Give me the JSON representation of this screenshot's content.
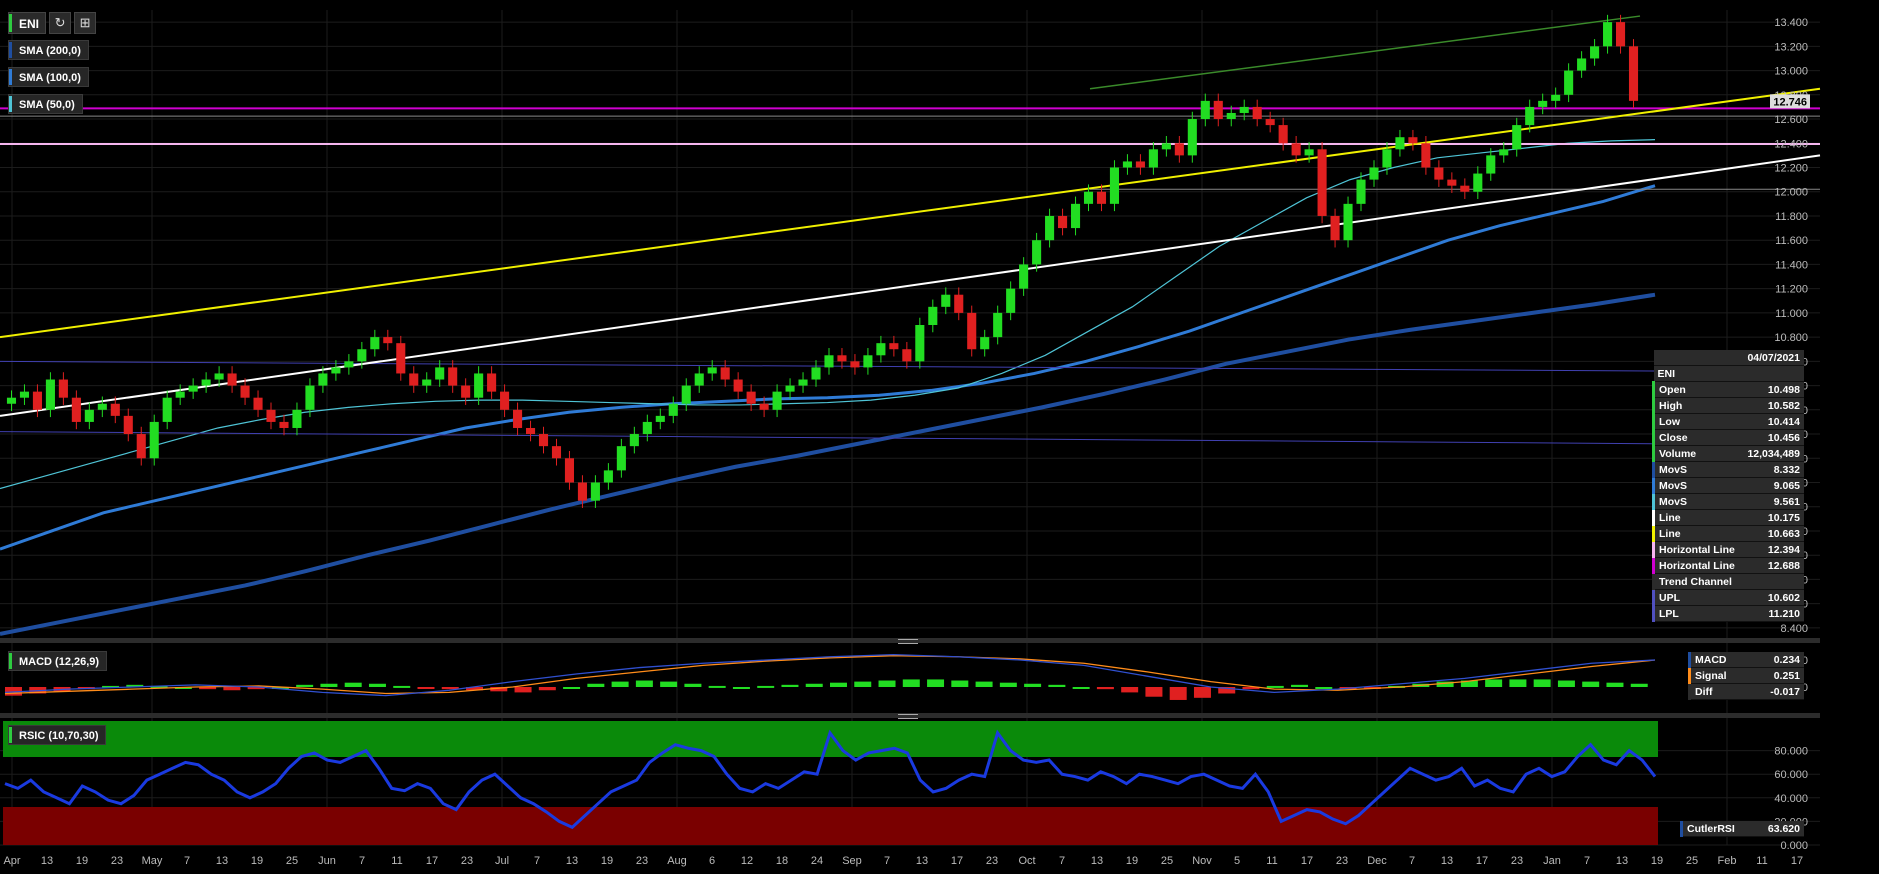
{
  "ticker": {
    "symbol": "ENI",
    "refresh_icon": "refresh-icon",
    "menu_icon": "grid-icon"
  },
  "overlays": [
    {
      "label": "SMA (200,0)",
      "color": "#1f4ea0"
    },
    {
      "label": "SMA (100,0)",
      "color": "#2f7bd6"
    },
    {
      "label": "SMA (50,0)",
      "color": "#4fc4d6"
    }
  ],
  "price_axis": {
    "ticks": [
      "13.400",
      "13.200",
      "13.000",
      "12.800",
      "12.600",
      "12.400",
      "12.200",
      "12.000",
      "11.800",
      "11.600",
      "11.400",
      "11.200",
      "11.000",
      "10.800",
      "10.600",
      "10.400",
      "10.200",
      "10.000",
      "9.800",
      "9.600",
      "9.400",
      "9.200",
      "9.000",
      "8.800",
      "8.600",
      "8.400"
    ],
    "last_price": "12.746"
  },
  "date_axis": [
    "Apr",
    "13",
    "19",
    "23",
    "May",
    "7",
    "13",
    "19",
    "25",
    "Jun",
    "7",
    "11",
    "17",
    "23",
    "Jul",
    "7",
    "13",
    "19",
    "23",
    "Aug",
    "6",
    "12",
    "18",
    "24",
    "Sep",
    "7",
    "13",
    "17",
    "23",
    "Oct",
    "7",
    "13",
    "19",
    "25",
    "Nov",
    "5",
    "11",
    "17",
    "23",
    "Dec",
    "7",
    "13",
    "17",
    "23",
    "Jan",
    "7",
    "13",
    "19",
    "25",
    "Feb",
    "11",
    "17"
  ],
  "info_panel": {
    "date": "04/07/2021",
    "name": "ENI",
    "rows": [
      {
        "label": "Open",
        "value": "10.498",
        "color": "#2ecc40"
      },
      {
        "label": "High",
        "value": "10.582",
        "color": "#2ecc40"
      },
      {
        "label": "Low",
        "value": "10.414",
        "color": "#2ecc40"
      },
      {
        "label": "Close",
        "value": "10.456",
        "color": "#2ecc40"
      },
      {
        "label": "Volume",
        "value": "12,034,489",
        "color": "#2ecc40"
      },
      {
        "label": "MovS",
        "value": "8.332",
        "color": "#1f4ea0"
      },
      {
        "label": "MovS",
        "value": "9.065",
        "color": "#2f7bd6"
      },
      {
        "label": "MovS",
        "value": "9.561",
        "color": "#4fc4d6"
      },
      {
        "label": "Line",
        "value": "10.175",
        "color": "#ffffff"
      },
      {
        "label": "Line",
        "value": "10.663",
        "color": "#f0f000"
      },
      {
        "label": "Horizontal Line",
        "value": "12.394",
        "color": "#f6b6f0"
      },
      {
        "label": "Horizontal Line",
        "value": "12.688",
        "color": "#d000d0"
      },
      {
        "label": "Trend Channel",
        "value": "",
        "color": "#2b2b2b"
      },
      {
        "label": "UPL",
        "value": "10.602",
        "color": "#5050c0"
      },
      {
        "label": "LPL",
        "value": "11.210",
        "color": "#5050c0"
      }
    ]
  },
  "macd": {
    "label": "MACD (12,26,9)",
    "axis": [
      "0.250",
      "0.000"
    ],
    "rows": [
      {
        "label": "MACD",
        "value": "0.234",
        "color": "#1f4ea0"
      },
      {
        "label": "Signal",
        "value": "0.251",
        "color": "#ff8c1a"
      },
      {
        "label": "Diff",
        "value": "-0.017",
        "color": "#2b2b2b"
      }
    ]
  },
  "rsi": {
    "label": "RSIC (10,70,30)",
    "axis": [
      "80.000",
      "60.000",
      "40.000",
      "20.000",
      "0.000"
    ],
    "row": {
      "label": "CutlerRSI",
      "value": "63.620",
      "color": "#1f4ea0"
    }
  },
  "chart_data": {
    "type": "candlestick",
    "x_axis": "date (Apr 2021 – Feb 2022)",
    "ylim": [
      8.3,
      13.5
    ],
    "close": [
      10.3,
      10.35,
      10.2,
      10.45,
      10.3,
      10.1,
      10.2,
      10.25,
      10.15,
      10.0,
      9.8,
      10.1,
      10.3,
      10.35,
      10.4,
      10.45,
      10.5,
      10.4,
      10.3,
      10.2,
      10.1,
      10.05,
      10.2,
      10.4,
      10.5,
      10.55,
      10.6,
      10.7,
      10.8,
      10.75,
      10.5,
      10.4,
      10.45,
      10.55,
      10.4,
      10.3,
      10.5,
      10.35,
      10.2,
      10.05,
      10.0,
      9.9,
      9.8,
      9.6,
      9.45,
      9.6,
      9.7,
      9.9,
      10.0,
      10.1,
      10.15,
      10.25,
      10.4,
      10.5,
      10.55,
      10.45,
      10.35,
      10.25,
      10.2,
      10.35,
      10.4,
      10.45,
      10.55,
      10.65,
      10.6,
      10.55,
      10.65,
      10.75,
      10.7,
      10.6,
      10.9,
      11.05,
      11.15,
      11.0,
      10.7,
      10.8,
      11.0,
      11.2,
      11.4,
      11.6,
      11.8,
      11.7,
      11.9,
      12.0,
      11.9,
      12.2,
      12.25,
      12.2,
      12.35,
      12.4,
      12.3,
      12.6,
      12.75,
      12.6,
      12.65,
      12.7,
      12.6,
      12.55,
      12.4,
      12.3,
      12.35,
      11.8,
      11.6,
      11.9,
      12.1,
      12.2,
      12.35,
      12.45,
      12.4,
      12.2,
      12.1,
      12.05,
      12.0,
      12.15,
      12.3,
      12.35,
      12.55,
      12.7,
      12.75,
      12.8,
      13.0,
      13.1,
      13.2,
      13.4,
      13.2,
      12.75
    ],
    "sma50": [
      9.55,
      9.65,
      9.75,
      9.85,
      9.95,
      10.05,
      10.12,
      10.18,
      10.22,
      10.25,
      10.27,
      10.28,
      10.28,
      10.27,
      10.26,
      10.25,
      10.24,
      10.24,
      10.25,
      10.26,
      10.28,
      10.32,
      10.38,
      10.5,
      10.65,
      10.85,
      11.05,
      11.3,
      11.55,
      11.75,
      11.95,
      12.1,
      12.2,
      12.28,
      12.32,
      12.36,
      12.4,
      12.42,
      12.43
    ],
    "sma100": [
      9.05,
      9.2,
      9.35,
      9.45,
      9.55,
      9.65,
      9.75,
      9.85,
      9.95,
      10.05,
      10.12,
      10.18,
      10.22,
      10.25,
      10.27,
      10.29,
      10.3,
      10.32,
      10.36,
      10.42,
      10.5,
      10.6,
      10.72,
      10.85,
      11.0,
      11.15,
      11.3,
      11.45,
      11.6,
      11.72,
      11.82,
      11.92,
      12.05
    ],
    "sma200": [
      8.35,
      8.45,
      8.55,
      8.65,
      8.75,
      8.87,
      9.0,
      9.12,
      9.25,
      9.38,
      9.5,
      9.62,
      9.73,
      9.82,
      9.92,
      10.02,
      10.12,
      10.22,
      10.33,
      10.45,
      10.58,
      10.68,
      10.78,
      10.86,
      10.93,
      11.0,
      11.07,
      11.15
    ],
    "horizontal_lines": [
      12.394,
      12.688
    ],
    "trend_lines": [
      {
        "color": "white",
        "start": 10.15,
        "end": 12.3
      },
      {
        "color": "yellow",
        "start": 10.8,
        "end": 12.85
      }
    ],
    "rsi": [
      52,
      48,
      55,
      45,
      40,
      35,
      50,
      45,
      38,
      35,
      42,
      55,
      60,
      65,
      70,
      68,
      60,
      55,
      45,
      40,
      45,
      52,
      65,
      75,
      78,
      72,
      70,
      75,
      80,
      65,
      48,
      46,
      52,
      48,
      35,
      30,
      45,
      55,
      60,
      50,
      40,
      35,
      28,
      20,
      15,
      25,
      35,
      45,
      50,
      55,
      70,
      78,
      85,
      82,
      80,
      75,
      60,
      48,
      45,
      52,
      48,
      55,
      62,
      60,
      95,
      80,
      72,
      78,
      80,
      82,
      78,
      55,
      45,
      48,
      55,
      60,
      58,
      95,
      80,
      72,
      70,
      72,
      60,
      58,
      55,
      62,
      58,
      52,
      60,
      58,
      55,
      52,
      58,
      60,
      55,
      50,
      48,
      60,
      45,
      20,
      25,
      30,
      28,
      22,
      18,
      25,
      35,
      45,
      55,
      65,
      60,
      55,
      58,
      65,
      50,
      55,
      48,
      45,
      60,
      65,
      58,
      62,
      75,
      85,
      72,
      68,
      80,
      72,
      58
    ],
    "macd_hist": [
      -0.08,
      -0.06,
      -0.04,
      -0.02,
      0.01,
      0.02,
      0.01,
      0.0,
      -0.02,
      -0.03,
      -0.02,
      0.0,
      0.02,
      0.03,
      0.04,
      0.03,
      0.01,
      -0.01,
      -0.02,
      -0.03,
      -0.04,
      -0.05,
      -0.03,
      0.0,
      0.03,
      0.05,
      0.06,
      0.05,
      0.03,
      0.01,
      0.0,
      0.01,
      0.02,
      0.03,
      0.04,
      0.05,
      0.06,
      0.07,
      0.07,
      0.06,
      0.05,
      0.04,
      0.03,
      0.02,
      0.0,
      -0.02,
      -0.05,
      -0.09,
      -0.12,
      -0.1,
      -0.06,
      -0.02,
      0.01,
      0.02,
      0.0,
      -0.02,
      -0.01,
      0.01,
      0.03,
      0.05,
      0.06,
      0.07,
      0.07,
      0.07,
      0.06,
      0.05,
      0.04,
      0.03
    ],
    "macd_line": [
      -0.05,
      -0.02,
      0.0,
      0.02,
      0.0,
      -0.05,
      -0.08,
      -0.03,
      0.05,
      0.12,
      0.18,
      0.22,
      0.25,
      0.28,
      0.3,
      0.28,
      0.25,
      0.2,
      0.1,
      0.0,
      -0.05,
      -0.02,
      0.03,
      0.08,
      0.15,
      0.22,
      0.25
    ],
    "signal_line": [
      -0.06,
      -0.04,
      -0.02,
      0.0,
      0.01,
      -0.02,
      -0.06,
      -0.05,
      0.0,
      0.08,
      0.14,
      0.2,
      0.24,
      0.27,
      0.29,
      0.28,
      0.26,
      0.22,
      0.14,
      0.05,
      -0.02,
      -0.03,
      0.0,
      0.05,
      0.12,
      0.19,
      0.25
    ]
  }
}
